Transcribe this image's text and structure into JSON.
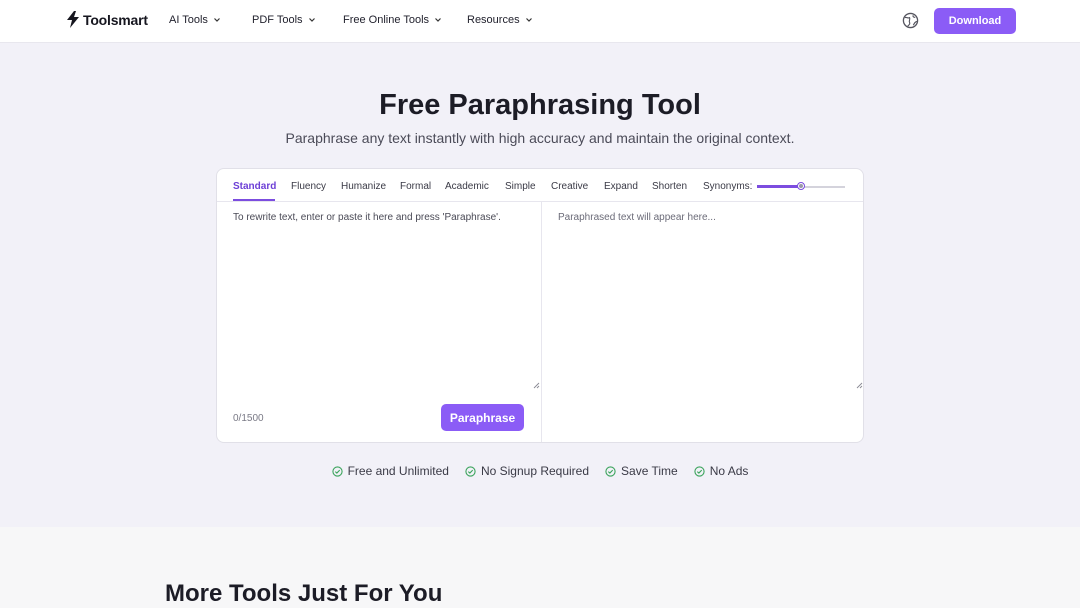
{
  "brand": {
    "name": "Toolsmart",
    "accent": "#8b5cf6"
  },
  "nav": {
    "items": [
      {
        "label": "AI Tools"
      },
      {
        "label": "PDF Tools"
      },
      {
        "label": "Free Online Tools"
      },
      {
        "label": "Resources"
      }
    ],
    "language_icon": "globe-icon",
    "download_label": "Download"
  },
  "hero": {
    "title": "Free Paraphrasing Tool",
    "subtitle": "Paraphrase any text instantly with high accuracy and maintain the original context."
  },
  "tool": {
    "modes": [
      "Standard",
      "Fluency",
      "Humanize",
      "Formal",
      "Academic",
      "Simple",
      "Creative",
      "Expand",
      "Shorten"
    ],
    "active_mode": "Standard",
    "synonyms_label": "Synonyms:",
    "synonyms_level": 0.5,
    "input_value": "",
    "input_placeholder": "To rewrite text, enter or paste it here and press 'Paraphrase'.",
    "output_placeholder": "Paraphrased text will appear here...",
    "counter": "0/1500",
    "button_label": "Paraphrase"
  },
  "features": [
    "Free and Unlimited",
    "No Signup Required",
    "Save Time",
    "No Ads"
  ],
  "more_tools": {
    "title": "More Tools Just For You"
  }
}
